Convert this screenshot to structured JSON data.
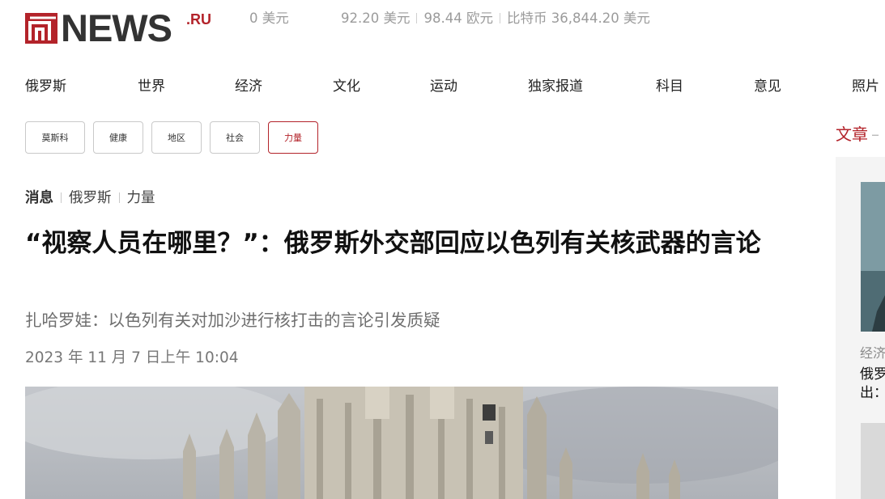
{
  "header": {
    "logo_text": "NEWS",
    "logo_tld": ".RU",
    "ticker": {
      "item1": "0 美元",
      "item2": "92.20 美元",
      "item3": "98.44 欧元",
      "item4": "比特币 36,844.20 美元"
    }
  },
  "nav": [
    "俄罗斯",
    "世界",
    "经济",
    "文化",
    "运动",
    "独家报道",
    "科目",
    "意见",
    "照片"
  ],
  "tags": [
    "莫斯科",
    "健康",
    "地区",
    "社会",
    "力量"
  ],
  "sidebar": {
    "title": "文章",
    "title_dash": "–",
    "category": "经济",
    "text_line1": "俄罗",
    "text_line2": "出："
  },
  "article": {
    "breadcrumb": [
      "消息",
      "俄罗斯",
      "力量"
    ],
    "headline": "“视察人员在哪里？”：俄罗斯外交部回应以色列有关核武器的言论",
    "subtitle": "扎哈罗娃：以色列有关对加沙进行核打击的言论引发质疑",
    "date": "2023 年 11 月 7 日上午 10:04"
  },
  "colors": {
    "accent": "#b3232a",
    "text": "#222222",
    "muted": "#777777"
  }
}
